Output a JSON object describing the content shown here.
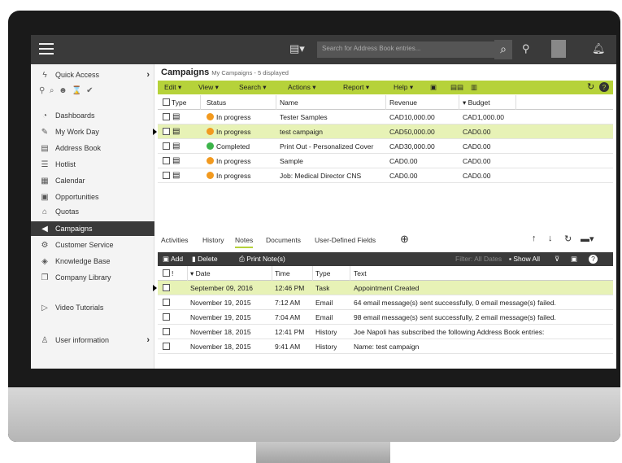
{
  "topbar": {
    "search_placeholder": "Search for Address Book entries..."
  },
  "sidebar": {
    "quick_access": "Quick Access",
    "items": [
      {
        "label": "Dashboards",
        "icon": "dashboard-icon"
      },
      {
        "label": "My Work Day",
        "icon": "edit-icon"
      },
      {
        "label": "Address Book",
        "icon": "book-icon"
      },
      {
        "label": "Hotlist",
        "icon": "list-icon"
      },
      {
        "label": "Calendar",
        "icon": "calendar-icon"
      },
      {
        "label": "Opportunities",
        "icon": "briefcase-icon"
      },
      {
        "label": "Quotas",
        "icon": "bank-icon"
      },
      {
        "label": "Campaigns",
        "icon": "megaphone-icon"
      },
      {
        "label": "Customer Service",
        "icon": "support-icon"
      },
      {
        "label": "Knowledge Base",
        "icon": "layers-icon"
      },
      {
        "label": "Company Library",
        "icon": "folder-icon"
      }
    ],
    "video_tutorials": "Video Tutorials",
    "user_information": "User information"
  },
  "campaigns": {
    "title": "Campaigns",
    "subtitle": "My Campaigns - 5 displayed",
    "menu": [
      "Edit",
      "View",
      "Search",
      "Actions",
      "Report",
      "Help"
    ],
    "columns": [
      "Type",
      "Status",
      "Name",
      "Revenue",
      "Budget"
    ],
    "rows": [
      {
        "status": "In progress",
        "status_color": "#f29a1f",
        "name": "Tester Samples",
        "revenue": "CAD10,000.00",
        "budget": "CAD1,000.00"
      },
      {
        "status": "In progress",
        "status_color": "#f29a1f",
        "name": "test campaign",
        "revenue": "CAD50,000.00",
        "budget": "CAD0.00"
      },
      {
        "status": "Completed",
        "status_color": "#3cb44a",
        "name": "Print Out - Personalized Cover",
        "revenue": "CAD30,000.00",
        "budget": "CAD0.00"
      },
      {
        "status": "In progress",
        "status_color": "#f29a1f",
        "name": "Sample",
        "revenue": "CAD0.00",
        "budget": "CAD0.00"
      },
      {
        "status": "In progress",
        "status_color": "#f29a1f",
        "name": "Job: Medical Director CNS",
        "revenue": "CAD0.00",
        "budget": "CAD0.00"
      }
    ]
  },
  "tabs": [
    "Activities",
    "History",
    "Notes",
    "Documents",
    "User-Defined Fields"
  ],
  "notes": {
    "add": "Add",
    "delete": "Delete",
    "print": "Print Note(s)",
    "filter": "Filter: All Dates",
    "show_all": "Show All",
    "columns": [
      "!",
      "Date",
      "Time",
      "Type",
      "Text"
    ],
    "rows": [
      {
        "date": "September 09, 2016",
        "time": "12:46 PM",
        "type": "Task",
        "text": "Appointment Created"
      },
      {
        "date": "November 19, 2015",
        "time": "7:12 AM",
        "type": "Email",
        "text": "64 email message(s) sent successfully, 0 email message(s) failed."
      },
      {
        "date": "November 19, 2015",
        "time": "7:04 AM",
        "type": "Email",
        "text": "98 email message(s) sent successfully, 2 email message(s) failed."
      },
      {
        "date": "November 18, 2015",
        "time": "12:41 PM",
        "type": "History",
        "text": "Joe Napoli has subscribed the following Address Book entries:"
      },
      {
        "date": "November 18, 2015",
        "time": "9:41 AM",
        "type": "History",
        "text": "Name: test campaign"
      }
    ]
  },
  "colors": {
    "accent": "#b6d23a",
    "dark": "#3a3a3a"
  }
}
